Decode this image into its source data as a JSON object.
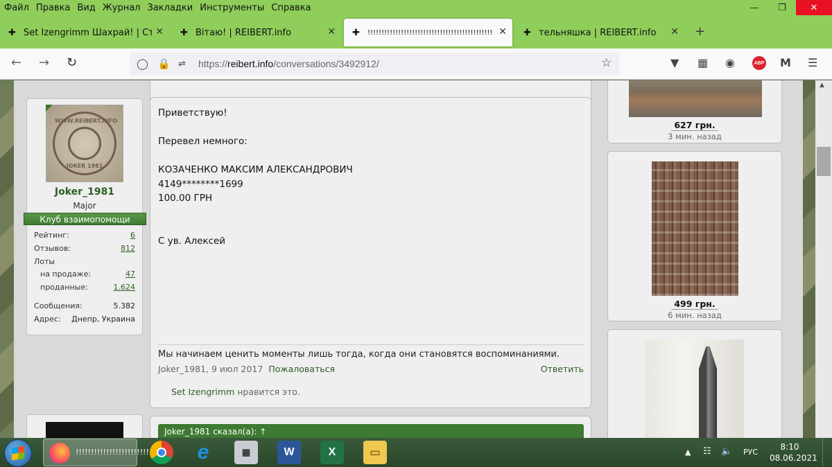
{
  "menubar": [
    "Файл",
    "Правка",
    "Вид",
    "Журнал",
    "Закладки",
    "Инструменты",
    "Справка"
  ],
  "tabs": [
    {
      "title": "Set Izengrimm Шахрай! | Стран",
      "active": false
    },
    {
      "title": "Вітаю! | REIBERT.info",
      "active": false
    },
    {
      "title": "!!!!!!!!!!!!!!!!!!!!!!!!!!!!!!!!!!!!!!!!!!!!!! |",
      "active": true
    },
    {
      "title": "тельняшка | REIBERT.info",
      "active": false
    }
  ],
  "url": {
    "prefix": "https://",
    "domain": "reibert.info",
    "path": "/conversations/3492912/"
  },
  "author": {
    "name": "Joker_1981",
    "rank": "Major",
    "club": "Клуб взаимопомощи",
    "avatar_top": "WWW.REIBERT.INFO",
    "avatar_bottom": "JOKER 1981",
    "stats": {
      "rating_label": "Рейтинг:",
      "rating": "6",
      "reviews_label": "Отзывов:",
      "reviews": "812",
      "lots_label": "Лоты",
      "on_sale_label": "на продаже:",
      "on_sale": "47",
      "sold_label": "проданные:",
      "sold": "1.624",
      "messages_label": "Сообщения:",
      "messages": "5.382",
      "address_label": "Адрес:",
      "address": "Днепр, Украина"
    }
  },
  "post": {
    "body": "Приветствую!\n\nПеревел немного:\n\nКОЗАЧЕНКО МАКСИМ АЛЕКСАНДРОВИЧ\n4149********1699\n100.00 ГРН\n\n\nС ув. Алексей",
    "signature": "Мы начинаем ценить моменты лишь тогда, когда они становятся воспоминаниями.",
    "author_date": "Joker_1981, 9 июл 2017",
    "report": "Пожаловаться",
    "reply": "Ответить",
    "liker": "Set Izengrimm",
    "likes_suffix": " нравится это."
  },
  "next_post": {
    "quote_header": "Joker_1981 сказал(а): ↑"
  },
  "lots": [
    {
      "price": "627 грн.",
      "ago": "3 мин. назад"
    },
    {
      "price": "499 грн.",
      "ago": "6 мин. назад"
    }
  ],
  "taskbar": {
    "task_label": "!!!!!!!!!!!!!!!!!!!!!!!!!!!",
    "lang": "РУС",
    "time": "8:10",
    "date": "08.06.2021"
  },
  "icons": {
    "back": "arrow-left-icon",
    "forward": "arrow-right-icon",
    "reload": "reload-icon",
    "shield": "shield-icon",
    "lock": "lock-icon",
    "permissions": "permissions-icon",
    "bookmark": "star-icon",
    "pocket": "pocket-icon",
    "screenshot": "screenshot-icon",
    "globe": "globe-icon",
    "adblock": "adblock-icon",
    "extension": "m-icon",
    "menu": "hamburger-icon"
  },
  "colors": {
    "chrome": "#8fce5a",
    "accent": "#2d5e24",
    "club": "#3d7a32",
    "close": "#e81123"
  }
}
